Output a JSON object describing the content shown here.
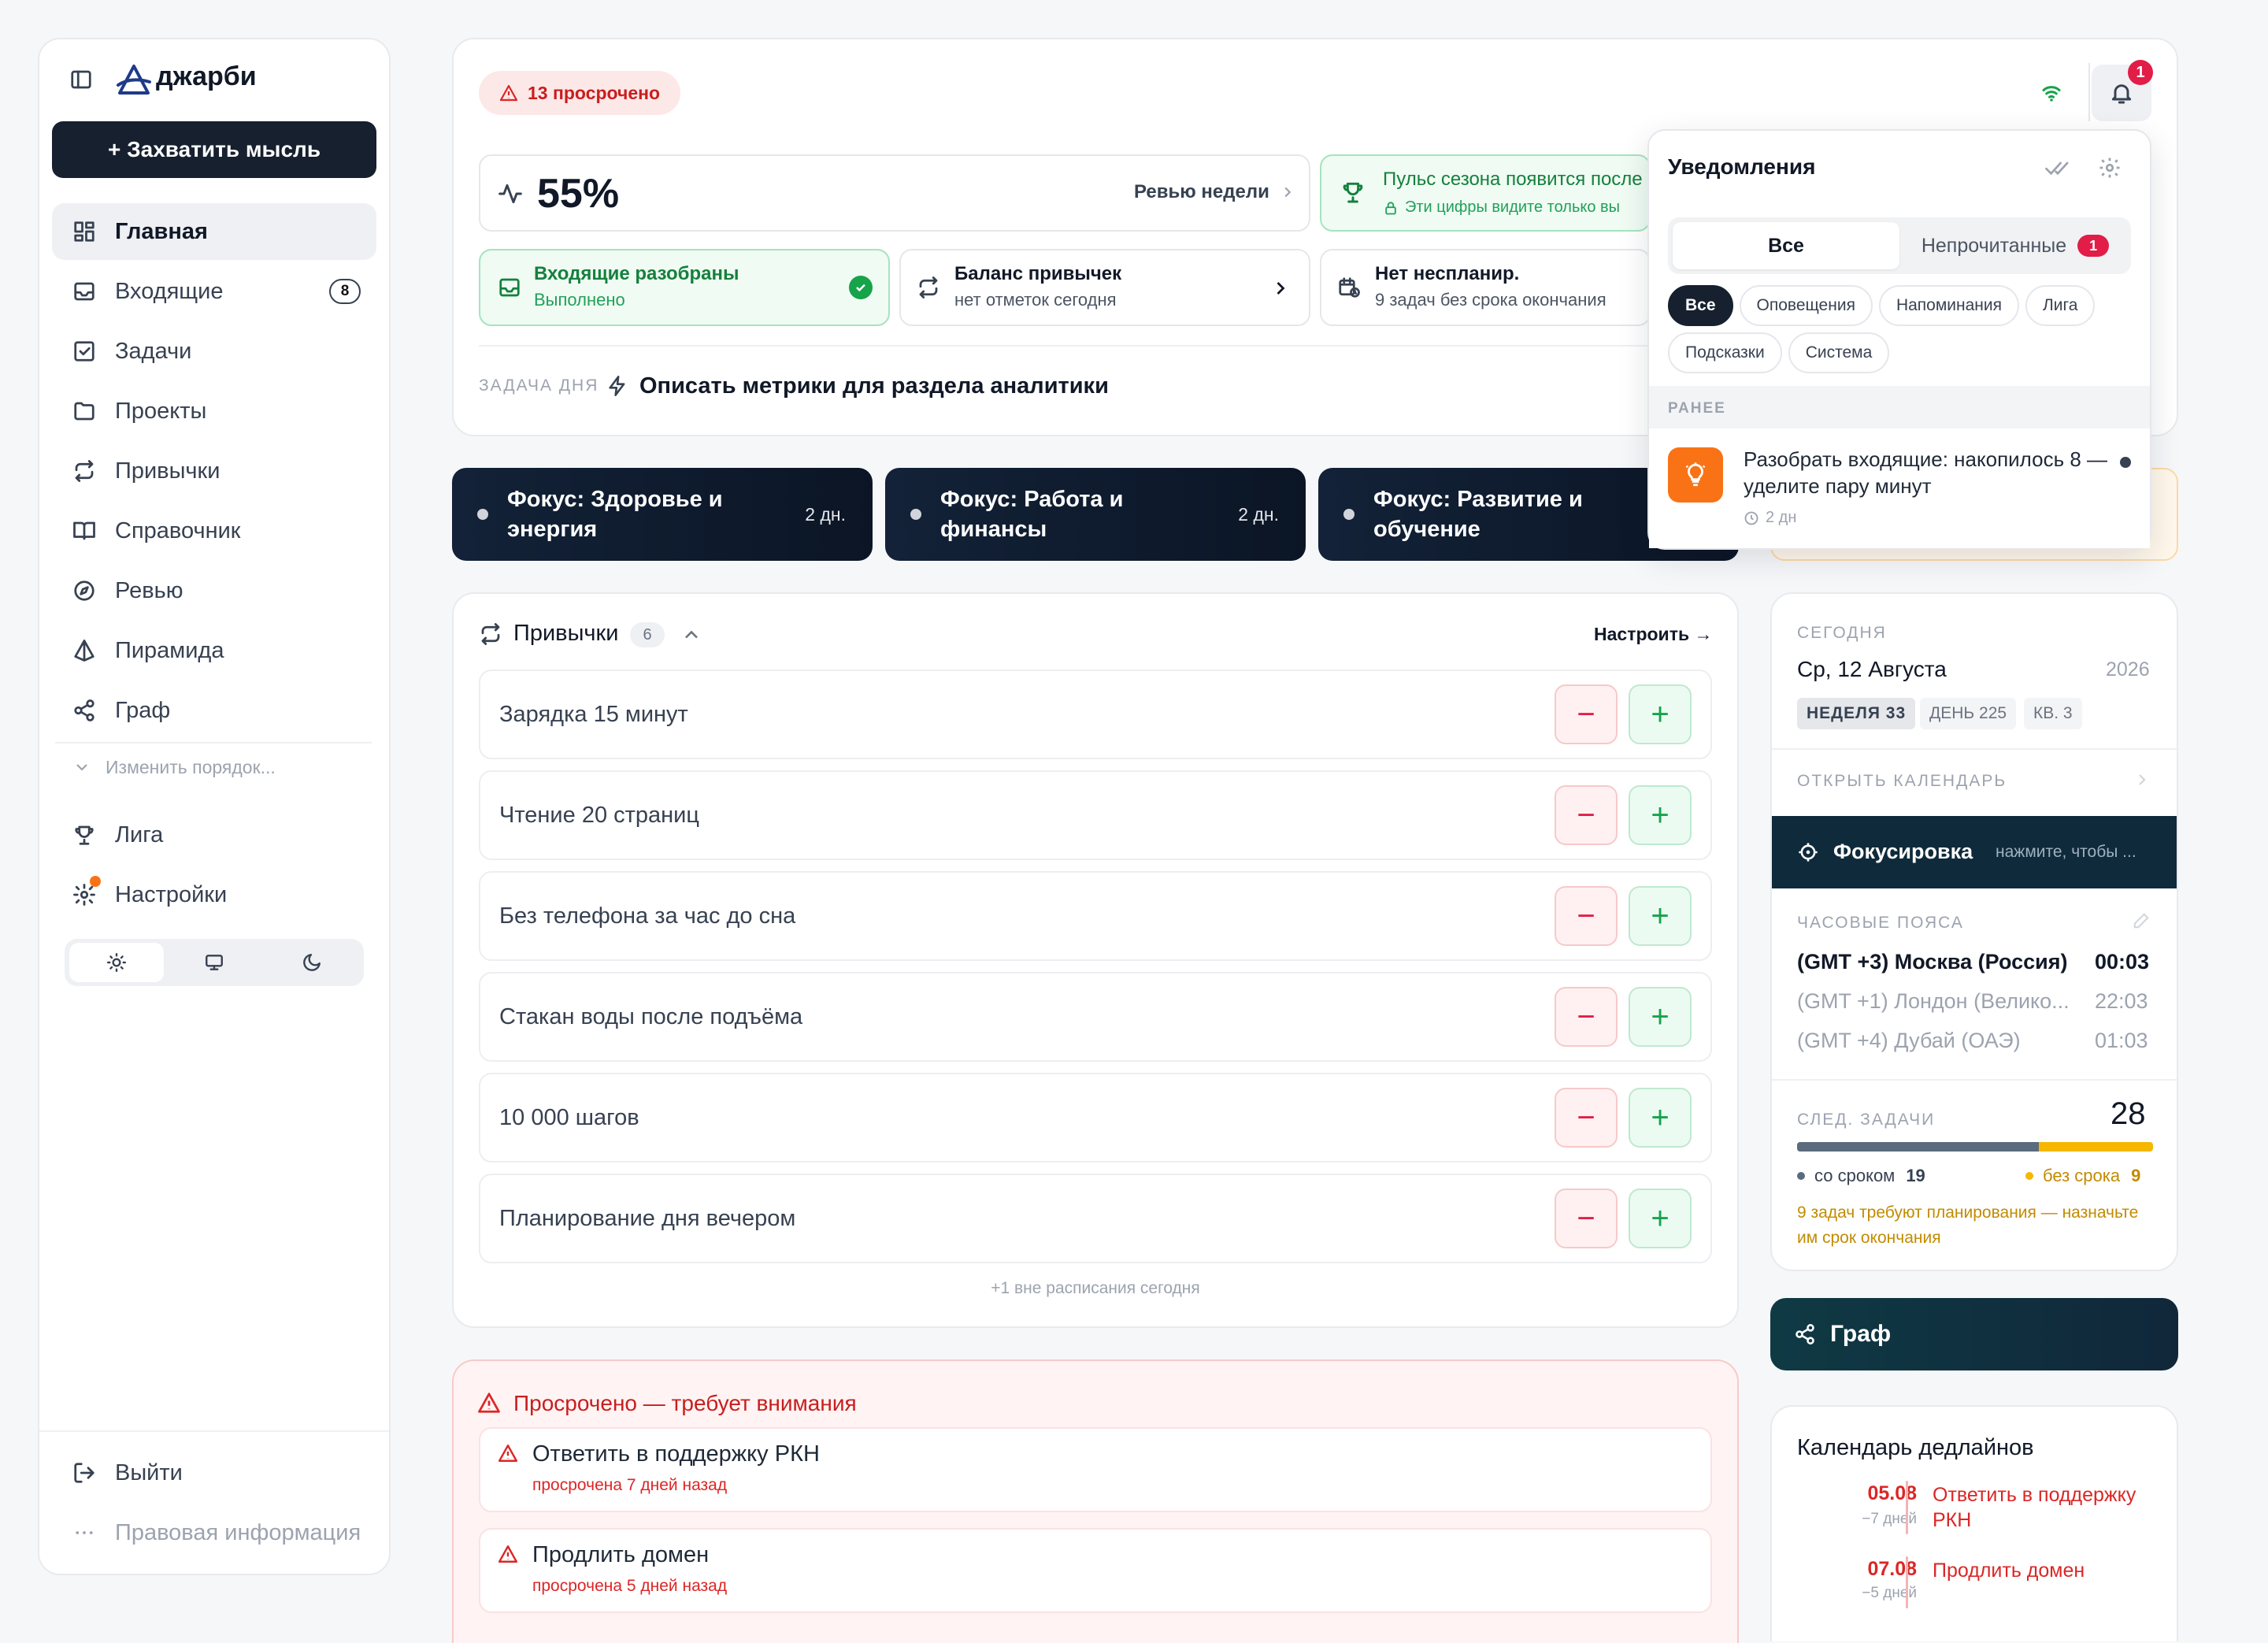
{
  "sidebar": {
    "brand": "джарби",
    "capture_button": "+ Захватить мысль",
    "items": [
      {
        "label": "Главная",
        "icon": "dashboard-icon"
      },
      {
        "label": "Входящие",
        "icon": "inbox-icon",
        "badge": "8"
      },
      {
        "label": "Задачи",
        "icon": "check-square-icon"
      },
      {
        "label": "Проекты",
        "icon": "folder-icon"
      },
      {
        "label": "Привычки",
        "icon": "repeat-icon"
      },
      {
        "label": "Справочник",
        "icon": "book-icon"
      },
      {
        "label": "Ревью",
        "icon": "compass-icon"
      },
      {
        "label": "Пирамида",
        "icon": "pyramid-icon"
      },
      {
        "label": "Граф",
        "icon": "share-icon"
      }
    ],
    "reorder": "Изменить порядок...",
    "bottom_items": [
      {
        "label": "Лига",
        "icon": "trophy-icon"
      },
      {
        "label": "Настройки",
        "icon": "gear-icon"
      }
    ],
    "logout": "Выйти",
    "legal": "Правовая информация"
  },
  "header": {
    "overdue_badge": "13 просрочено",
    "notifications_count": "1"
  },
  "stats": {
    "pulse_value": "55%",
    "review_link": "Ревью недели",
    "season_title": "Пульс сезона появится после",
    "season_sub": "Эти цифры видите только вы",
    "inbox_title": "Входящие разобраны",
    "inbox_sub": "Выполнено",
    "balance_title": "Баланс привычек",
    "balance_sub": "нет отметок сегодня",
    "unplanned_title": "Нет неспланир.",
    "unplanned_sub": "9 задач без срока окончания"
  },
  "task_of_day": {
    "label": "ЗАДАЧА ДНЯ",
    "text": "Описать метрики для раздела аналитики"
  },
  "focus_cards": [
    {
      "title": "Фокус: Здоровье и энергия",
      "days": "2 дн."
    },
    {
      "title": "Фокус: Работа и финансы",
      "days": "2 дн."
    },
    {
      "title": "Фокус: Развитие и обучение",
      "days": ""
    }
  ],
  "habits": {
    "title": "Привычки",
    "count": "6",
    "configure": "Настроить →",
    "items": [
      "Зарядка 15 минут",
      "Чтение 20 страниц",
      "Без телефона за час до сна",
      "Стакан воды после подъёма",
      "10 000 шагов",
      "Планирование дня вечером"
    ],
    "footer": "+1 вне расписания сегодня"
  },
  "overdue": {
    "title": "Просрочено — требует внимания",
    "items": [
      {
        "title": "Ответить в поддержку РКН",
        "sub": "просрочена 7 дней назад"
      },
      {
        "title": "Продлить домен",
        "sub": "просрочена 5 дней назад"
      }
    ]
  },
  "today": {
    "label": "СЕГОДНЯ",
    "date": "Ср, 12 Августа",
    "year": "2026",
    "week": "НЕДЕЛЯ 33",
    "day": "ДЕНЬ 225",
    "quarter": "КВ. 3",
    "open_calendar": "ОТКРЫТЬ КАЛЕНДАРЬ",
    "focus_title": "Фокусировка",
    "focus_hint": "нажмите, чтобы ...",
    "tz_label": "ЧАСОВЫЕ ПОЯСА",
    "timezones": [
      {
        "name": "(GMT +3) Москва (Россия)",
        "time": "00:03"
      },
      {
        "name": "(GMT +1) Лондон (Велико...",
        "time": "22:03"
      },
      {
        "name": "(GMT +4) Дубай (ОАЭ)",
        "time": "01:03"
      }
    ],
    "next_label": "СЛЕД. ЗАДАЧИ",
    "next_count": "28",
    "with_deadline_label": "со сроком",
    "with_deadline": "19",
    "without_deadline_label": "без срока",
    "without_deadline": "9",
    "deadline_fraction": 0.68,
    "warning": "9 задач требуют планирования — назначьте им срок окончания"
  },
  "graph_card": {
    "title": "Граф"
  },
  "deadlines": {
    "title": "Календарь дедлайнов",
    "items": [
      {
        "date": "05.08",
        "rel": "−7 дней",
        "title": "Ответить в поддержку РКН"
      },
      {
        "date": "07.08",
        "rel": "−5 дней",
        "title": "Продлить домен"
      }
    ]
  },
  "notifications": {
    "title": "Уведомления",
    "tab_all": "Все",
    "tab_unread": "Непрочитанные",
    "unread_count": "1",
    "filters": [
      "Все",
      "Оповещения",
      "Напоминания",
      "Лига",
      "Подсказки",
      "Система"
    ],
    "section": "РАНЕЕ",
    "item_text": "Разобрать входящие: накопилось 8 — уделите пару минут",
    "item_time": "2 дн"
  },
  "colors": {
    "dark": "#16202e",
    "danger": "#dc2626",
    "success": "#16a34a",
    "amber": "#f5b700",
    "accent_orange": "#f97316"
  }
}
